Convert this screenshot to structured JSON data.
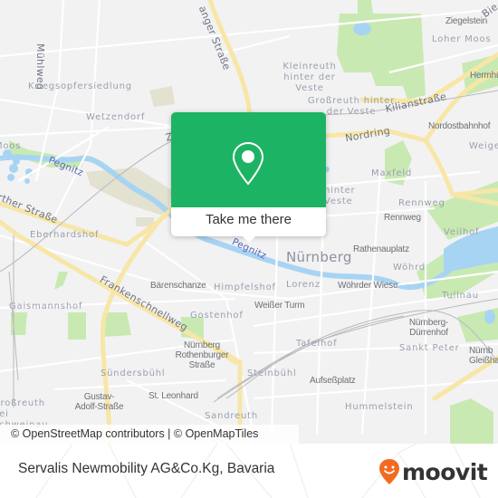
{
  "map": {
    "city_label": "Nürnberg",
    "district_labels": [
      {
        "text": "Kriegsopfersiedlung",
        "style": "district"
      },
      {
        "text": "Wetzendorf",
        "style": "district"
      },
      {
        "text": "Kleinreuth hinter der Veste",
        "style": "district"
      },
      {
        "text": "Großreuth hinter der Veste",
        "style": "district"
      },
      {
        "text": "Loher Moos",
        "style": "district"
      },
      {
        "text": "Maxfeld",
        "style": "district"
      },
      {
        "text": "hinter Veste",
        "style": "district"
      },
      {
        "text": "Rennweg",
        "style": "district"
      },
      {
        "text": "Veilhof",
        "style": "district"
      },
      {
        "text": "Wöhrd",
        "style": "district"
      },
      {
        "text": "Tullnau",
        "style": "district"
      },
      {
        "text": "Eberhardshof",
        "style": "district"
      },
      {
        "text": "Gaismannshof",
        "style": "district"
      },
      {
        "text": "Himpfelshof",
        "style": "district"
      },
      {
        "text": "Lorenz",
        "style": "district"
      },
      {
        "text": "Gostenhof",
        "style": "district"
      },
      {
        "text": "Tafelhof",
        "style": "district"
      },
      {
        "text": "Sankt Peter",
        "style": "district"
      },
      {
        "text": "Sündersbühl",
        "style": "district"
      },
      {
        "text": "Steinbühl",
        "style": "district"
      },
      {
        "text": "Sandreuth",
        "style": "district"
      },
      {
        "text": "Hummelstein",
        "style": "district"
      },
      {
        "text": "Großreuth bei Schweinau",
        "style": "district"
      },
      {
        "text": "Weige",
        "style": "district"
      },
      {
        "text": "Moos",
        "style": "district"
      }
    ],
    "poi_labels": [
      {
        "text": "Ziegelstein"
      },
      {
        "text": "Hermhü"
      },
      {
        "text": "Nordostbahnhof"
      },
      {
        "text": "Rennweg"
      },
      {
        "text": "Rathenauplatz"
      },
      {
        "text": "Wöhrder Wiese"
      },
      {
        "text": "Bärenschanze"
      },
      {
        "text": "Weißer Turm"
      },
      {
        "text": "Nürnberg-Dürrenhof"
      },
      {
        "text": "Nürnberg Rothenburger Straße"
      },
      {
        "text": "Aufseßplatz"
      },
      {
        "text": "St. Leonhard"
      },
      {
        "text": "Gustav-Adolf-Straße"
      },
      {
        "text": "Nürnb Gleißha"
      }
    ],
    "road_labels": [
      {
        "text": "Mühlweg"
      },
      {
        "text": "anger Straße"
      },
      {
        "text": "Kilianstraße"
      },
      {
        "text": "Nordring"
      },
      {
        "text": "rther Straße"
      },
      {
        "text": "Frankenschnellweg"
      },
      {
        "text": "Bie"
      },
      {
        "text": "Z"
      }
    ],
    "river_label": "Pegnitz",
    "colors": {
      "background": "#f2f2f3",
      "park": "#c9e9b3",
      "water": "#a8d4f3",
      "major_road": "#f8e6a6",
      "minor_road": "#ffffff",
      "rail": "#b9b9bd"
    }
  },
  "popup": {
    "icon": "map-pin-icon",
    "button_label": "Take me there",
    "accent_color": "#1db365"
  },
  "attribution": "© OpenStreetMap contributors | © OpenMapTiles",
  "footer": {
    "title": "Servalis Newmobility AG&Co.Kg, Bavaria",
    "logo_text": "moovit",
    "logo_color": "#f26b21"
  }
}
